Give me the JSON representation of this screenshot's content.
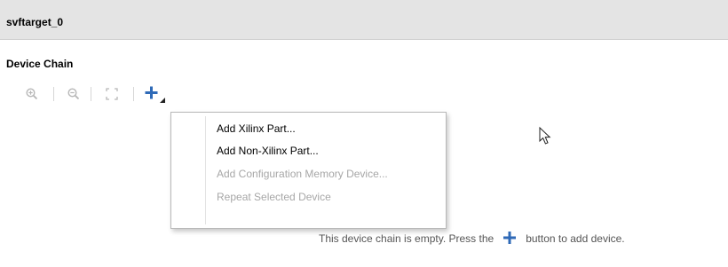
{
  "panel": {
    "title": "svftarget_0"
  },
  "section": {
    "title": "Device Chain"
  },
  "toolbar": {
    "icons": [
      "zoom-in-icon",
      "zoom-out-icon",
      "fit-icon",
      "add-device-icon"
    ],
    "accent": "#2f6ab7"
  },
  "menu": {
    "items": [
      {
        "label": "Add Xilinx Part...",
        "enabled": true
      },
      {
        "label": "Add Non-Xilinx Part...",
        "enabled": true
      },
      {
        "label": "Add Configuration Memory Device...",
        "enabled": false
      },
      {
        "label": "Repeat Selected Device",
        "enabled": false
      }
    ]
  },
  "empty_state": {
    "text_before": "This device chain is empty. Press the",
    "text_after": "button to add device."
  }
}
